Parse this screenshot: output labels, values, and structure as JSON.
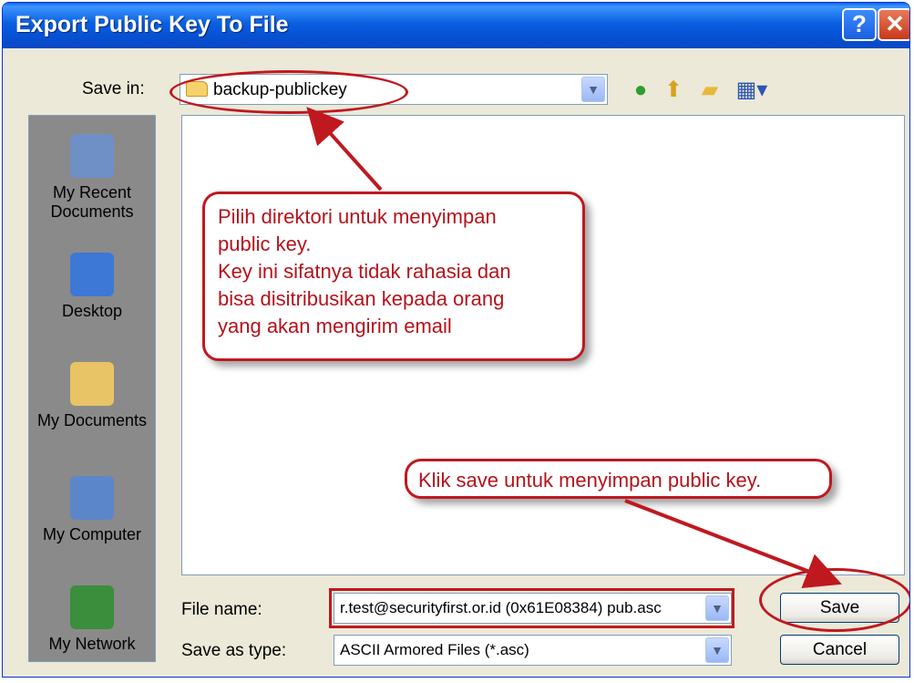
{
  "window": {
    "title": "Export Public Key To File",
    "help_glyph": "?",
    "close_glyph": "✕"
  },
  "save_in": {
    "label": "Save in:",
    "value": "backup-publickey"
  },
  "places": [
    {
      "label_lines": [
        "My Recent",
        "Documents"
      ],
      "icon": "recent-documents-icon"
    },
    {
      "label_lines": [
        "Desktop"
      ],
      "icon": "desktop-icon"
    },
    {
      "label_lines": [
        "My Documents"
      ],
      "icon": "my-documents-icon"
    },
    {
      "label_lines": [
        "My Computer"
      ],
      "icon": "my-computer-icon"
    },
    {
      "label_lines": [
        "My Network"
      ],
      "icon": "my-network-icon"
    }
  ],
  "callouts": {
    "directory": {
      "lines": [
        "Pilih direktori untuk menyimpan",
        "public key.",
        "Key ini sifatnya tidak rahasia dan",
        "bisa disitribusikan kepada orang",
        "yang akan mengirim email"
      ]
    },
    "save": {
      "text": "Klik save untuk menyimpan public key."
    }
  },
  "file_name": {
    "label": "File name:",
    "value": "r.test@securityfirst.or.id (0x61E08384) pub.asc"
  },
  "save_as_type": {
    "label": "Save as type:",
    "value": "ASCII Armored Files (*.asc)"
  },
  "buttons": {
    "save": "Save",
    "cancel": "Cancel"
  },
  "colors": {
    "annotation": "#c0181f",
    "titlebar": "#0a5fe0"
  }
}
